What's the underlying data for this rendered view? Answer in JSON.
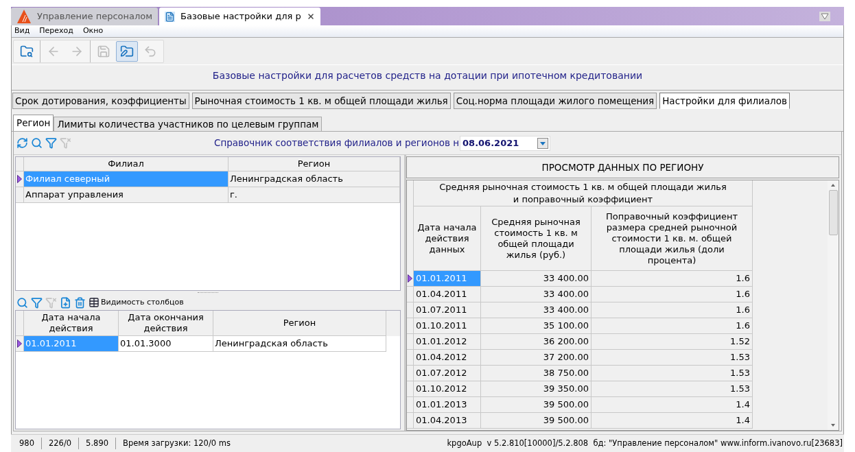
{
  "window_tabs": [
    {
      "label": "Управление персоналом",
      "selected": false,
      "kind": "app"
    },
    {
      "label": "Базовые настройки для р",
      "selected": true,
      "kind": "document"
    }
  ],
  "menu": [
    "Вид",
    "Переход",
    "Окно"
  ],
  "toolbar_groups": [
    {
      "buttons": [
        {
          "kind": "open",
          "disabled": false,
          "pressed": false
        }
      ]
    },
    {
      "buttons": [
        {
          "kind": "back",
          "disabled": true,
          "pressed": false
        },
        {
          "kind": "forward",
          "disabled": true,
          "pressed": false
        }
      ]
    },
    {
      "buttons": [
        {
          "kind": "save",
          "disabled": true,
          "pressed": false
        },
        {
          "kind": "edit",
          "disabled": false,
          "pressed": true
        },
        {
          "kind": "undo",
          "disabled": true,
          "pressed": false
        }
      ]
    }
  ],
  "page_title": "Базовые настройки для расчетов средств на дотации при ипотечном кредитовании",
  "section_tabs": [
    {
      "label": "Срок дотирования, коэффициенты",
      "selected": false
    },
    {
      "label": "Рыночная стоимость 1 кв. м общей площади жилья",
      "selected": false
    },
    {
      "label": "Соц.норма площади жилого помещения",
      "selected": false
    },
    {
      "label": "Настройки для филиалов",
      "selected": true
    }
  ],
  "sub_tabs": [
    {
      "label": "Регион",
      "selected": true
    },
    {
      "label": "Лимиты количества участников по целевым группам",
      "selected": false
    }
  ],
  "reference_toolbar": {
    "buttons": [
      {
        "kind": "refresh",
        "disabled": false
      },
      {
        "kind": "search",
        "disabled": false
      },
      {
        "kind": "filter",
        "disabled": false
      },
      {
        "kind": "clear-filter",
        "disabled": true
      }
    ],
    "title": "Справочник соответствия филиалов и регионов н",
    "date_field": "08.06.2021"
  },
  "branches_table": {
    "columns": [
      "Филиал",
      "Регион"
    ],
    "rows": [
      {
        "cells": [
          "Филиал северный",
          "Ленинградская область"
        ],
        "selected": true
      },
      {
        "cells": [
          "Аппарат управления",
          "г."
        ],
        "selected": false
      }
    ]
  },
  "periods_toolbar": {
    "buttons": [
      {
        "kind": "search",
        "disabled": false
      },
      {
        "kind": "filter",
        "disabled": false
      },
      {
        "kind": "clear-filter",
        "disabled": true
      },
      {
        "kind": "add",
        "disabled": false
      },
      {
        "kind": "delete",
        "disabled": false
      }
    ],
    "columns_button": "Видимость столбцов"
  },
  "periods_table": {
    "columns": [
      "Дата начала действия",
      "Дата окончания действия",
      "Регион"
    ],
    "rows": [
      {
        "cells": [
          "01.01.2011",
          "01.01.3000",
          "Ленинградская область"
        ],
        "selected": true
      }
    ]
  },
  "region_view": {
    "title": "ПРОСМОТР ДАННЫХ ПО РЕГИОНУ",
    "group_header": "Средняя рыночная стоимость 1 кв. м общей площади жилья и поправочный коэффициент",
    "columns": [
      "Дата начала действия данных",
      "Средняя рыночная стоимость 1 кв. м общей площади жилья (руб.)",
      "Поправочный коэффициент размера средней рыночной стоимости 1 кв. м. общей площади жилья (доли процента)"
    ],
    "rows": [
      {
        "cells": [
          "01.01.2011",
          "33 400.00",
          "1.6"
        ],
        "selected": true
      },
      {
        "cells": [
          "01.04.2011",
          "33 400.00",
          "1.6"
        ],
        "selected": false
      },
      {
        "cells": [
          "01.07.2011",
          "33 400.00",
          "1.6"
        ],
        "selected": false
      },
      {
        "cells": [
          "01.10.2011",
          "35 100.00",
          "1.6"
        ],
        "selected": false
      },
      {
        "cells": [
          "01.01.2012",
          "36 200.00",
          "1.52"
        ],
        "selected": false
      },
      {
        "cells": [
          "01.04.2012",
          "37 200.00",
          "1.53"
        ],
        "selected": false
      },
      {
        "cells": [
          "01.07.2012",
          "38 750.00",
          "1.53"
        ],
        "selected": false
      },
      {
        "cells": [
          "01.10.2012",
          "39 350.00",
          "1.53"
        ],
        "selected": false
      },
      {
        "cells": [
          "01.01.2013",
          "39 500.00",
          "1.4"
        ],
        "selected": false
      },
      {
        "cells": [
          "01.04.2013",
          "39 500.00",
          "1.4"
        ],
        "selected": false
      }
    ]
  },
  "status_bar": {
    "items": [
      "980",
      "226/0",
      "5.890",
      "Время загрузки: 120/0 ms"
    ],
    "version": "kpgoAup  v 5.2.810[10000]/5.2.808  бд: \"Управление персоналом\" www.inform.ivanovo.ru[23683]"
  }
}
